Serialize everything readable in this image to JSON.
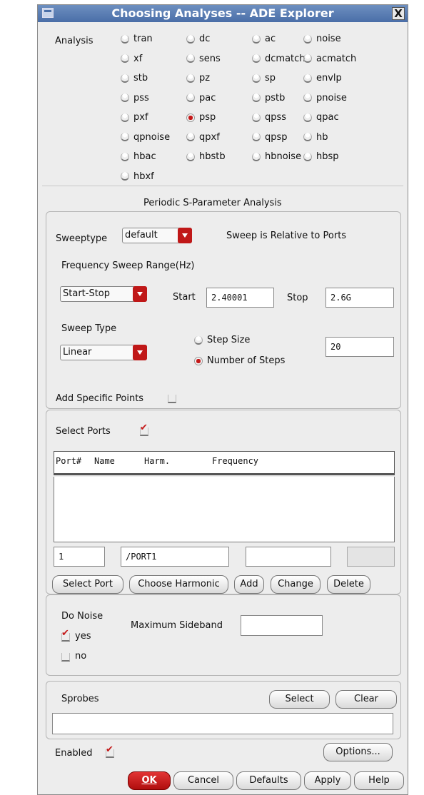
{
  "window": {
    "title": "Choosing Analyses -- ADE Explorer",
    "close_glyph": "X"
  },
  "analysis": {
    "label": "Analysis",
    "options": [
      "tran",
      "dc",
      "ac",
      "noise",
      "xf",
      "sens",
      "dcmatch",
      "acmatch",
      "stb",
      "pz",
      "sp",
      "envlp",
      "pss",
      "pac",
      "pstb",
      "pnoise",
      "pxf",
      "psp",
      "qpss",
      "qpac",
      "qpnoise",
      "qpxf",
      "qpsp",
      "hb",
      "hbac",
      "hbstb",
      "hbnoise",
      "hbsp",
      "hbxf"
    ],
    "selected": "psp"
  },
  "section_title": "Periodic S-Parameter Analysis",
  "sweep": {
    "sweeptype_label": "Sweeptype",
    "sweeptype_value": "default",
    "relative_text": "Sweep is Relative to Ports",
    "freq_range_label": "Frequency Sweep Range(Hz)",
    "range_mode": "Start-Stop",
    "start_label": "Start",
    "start_value": "2.40001",
    "stop_label": "Stop",
    "stop_value": "2.6G",
    "sweep_type_label": "Sweep Type",
    "sweep_type_value": "Linear",
    "step_size_label": "Step Size",
    "num_steps_label": "Number of Steps",
    "step_selected": "Number of Steps",
    "steps_value": "20",
    "add_points_label": "Add Specific Points",
    "add_points_checked": false
  },
  "ports": {
    "select_label": "Select Ports",
    "select_checked": true,
    "headers": {
      "port": "Port#",
      "name": "Name",
      "harm": "Harm.",
      "freq": "Frequency"
    },
    "port_num": "1",
    "port_name": "/PORT1",
    "harm_value": "",
    "freq_value": "",
    "buttons": {
      "select_port": "Select Port",
      "choose_harmonic": "Choose Harmonic",
      "add": "Add",
      "change": "Change",
      "delete": "Delete"
    }
  },
  "noise": {
    "label": "Do Noise",
    "yes": "yes",
    "no": "no",
    "selected": "yes",
    "max_sideband_label": "Maximum Sideband",
    "max_sideband_value": ""
  },
  "sprobes": {
    "label": "Sprobes",
    "select": "Select",
    "clear": "Clear",
    "value": ""
  },
  "footer": {
    "enabled_label": "Enabled",
    "enabled_checked": true,
    "options": "Options...",
    "ok": "OK",
    "cancel": "Cancel",
    "defaults": "Defaults",
    "apply": "Apply",
    "help": "Help"
  },
  "colors": {
    "title_bar": "#4a6ea8",
    "accent_red": "#c01818",
    "window_bg": "#ededed"
  }
}
